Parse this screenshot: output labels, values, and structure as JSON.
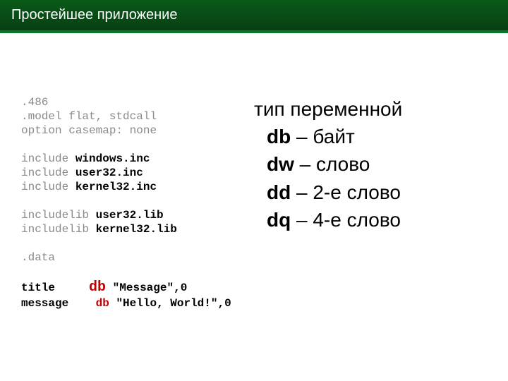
{
  "header": {
    "title": "Простейшее приложение"
  },
  "code": {
    "b1l1": ".486",
    "b1l2a": ".model",
    "b1l2b": "flat, stdcall",
    "b1l3a": "option",
    "b1l3b": "casemap: none",
    "b2l1a": "include",
    "b2l1b": "windows.inc",
    "b2l2a": "include",
    "b2l2b": "user32.inc",
    "b2l3a": "include",
    "b2l3b": "kernel32.inc",
    "b3l1a": "includelib",
    "b3l1b": "user32.lib",
    "b3l2a": "includelib",
    "b3l2b": "kernel32.lib",
    "b4l1": ".data",
    "b5l1a": "title",
    "b5l1b": "db",
    "b5l1c": "\"Message\",0",
    "b5l2a": "message",
    "b5l2b": "db",
    "b5l2c": "\"Hello, World!\",0"
  },
  "types": {
    "head": "тип переменной",
    "r1k": "db",
    "r1d": " – байт",
    "r2k": "dw",
    "r2d": " – слово",
    "r3k": "dd",
    "r3d": " – 2-е слово",
    "r4k": "dq",
    "r4d": " – 4-е слово"
  }
}
